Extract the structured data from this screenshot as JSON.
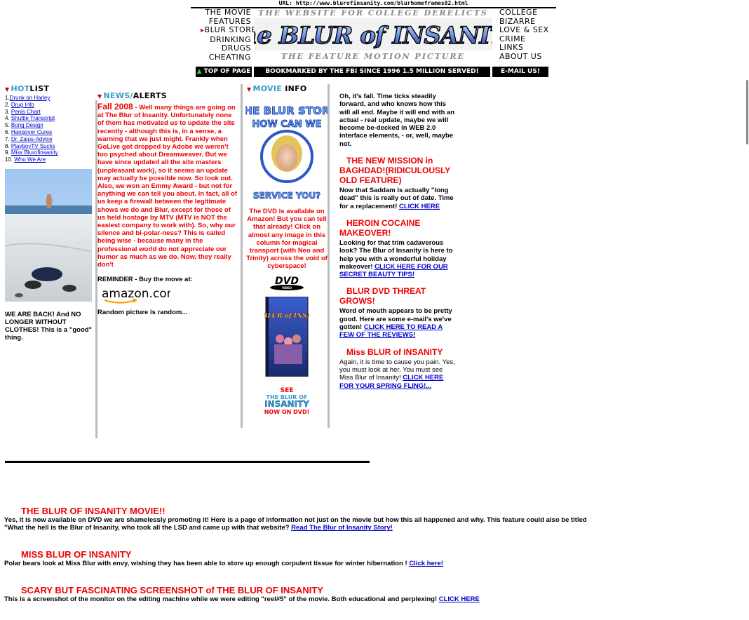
{
  "banner": {
    "url": "URL: http://www.blurofinsanity.com/blurhomeframes02.html",
    "tagline_top": "THE WEBSITE FOR COLLEGE DERELICTS",
    "logo_text": "The BLUR of INSANITY",
    "tagline_bottom": "THE FEATURE MOTION PICTURE",
    "nav_left": [
      "THE MOVIE",
      "FEATURES",
      "BLUR STORE",
      "DRINKING",
      "DRUGS",
      "CHEATING"
    ],
    "nav_right": [
      "COLLEGE",
      "BIZARRE",
      "LOVE & SEX",
      "CRIME",
      "LINKS",
      "ABOUT US"
    ],
    "top_of_page": "TOP OF PAGE",
    "bookmarked": "BOOKMARKED BY THE FBI SINCE 1996  1.5 MILLION SERVED!",
    "email": "E-MAIL US!"
  },
  "hotlist": {
    "title_a": "HOT",
    "title_b": "LIST",
    "items": [
      {
        "num": "1.",
        "label": "Drunk on Harley"
      },
      {
        "num": "2.",
        "label": "Drug Info"
      },
      {
        "num": "3.",
        "label": "Penis Chart"
      },
      {
        "num": "4.",
        "label": "Shuttle Transcript"
      },
      {
        "num": "5.",
        "label": "Bong Design"
      },
      {
        "num": "6.",
        "label": "Hangover Cures"
      },
      {
        "num": "7.",
        "label": "Dr. Zaius-Advice"
      },
      {
        "num": "8.",
        "label": "PlayboyTV Sucks"
      },
      {
        "num": "9.",
        "label": "Miss Blurofinsanity"
      },
      {
        "num": "10.",
        "label": "Who We Are"
      }
    ],
    "back_text": "WE ARE BACK! And NO LONGER WITHOUT CLOTHES! This is a \"good\" thing."
  },
  "news": {
    "title_a": "NEWS/",
    "title_b": "ALERTS",
    "season": "Fall 2008",
    "body": " - Well many things are going on at The Blur of Insanity. Unfortunately none of them has motivated us to update the site recently - although this is, in a sense, a warning that we just might. Frankly when GoLive got dropped by Adobe we weren't too psyched about Dreamweaver. But we have since updated all the site masters (unpleasant work), so it seems an update may actually be possible now. So look out. Also, we won an Emmy Award - but not for anything we can tell you about. In fact, all of us keep a firewall between the legitimate shows we do and Blur, except for those of us held hostage by MTV (MTV is NOT the easiest company to work with). So, why our silence and bi-polar-ness? This is called being wise - because many in the professional world do not appreciate our humor as much as we do. Now, they really don't",
    "reminder": "REMINDER - Buy the move at:",
    "amazon": "amazon.com",
    "random": "Random picture is random..."
  },
  "movie": {
    "title_a": "MOVIE ",
    "title_b": "INFO",
    "store_top": "THE BLUR STORE",
    "store_mid": "HOW CAN WE",
    "store_bot": "SERVICE YOU?",
    "dvd_text": "The DVD is available on Amazon! But you can tell that already! Click on almost any image in this column for magical transport (with Neo and Trinity) across the void of cyberspace!",
    "dvd_logo": "DVD",
    "dvd_video": "VIDEO",
    "box_title": "The BLUR of INSANITY",
    "see_1": "SEE",
    "see_2": "THE BLUR OF",
    "see_3": "INSANITY",
    "see_4": "NOW ON DVD!"
  },
  "features": {
    "intro": "Oh, it's fall. Time ticks steadily forward, and who knows how this will all end. Maybe it will end with an actual - real update, maybe we will become be-decked in WEB 2.0 interface elements, - or, well, maybe not.",
    "items": [
      {
        "title": "THE NEW MISSION in BAGHDAD!(RIDICULOUSLY OLD FEATURE)",
        "text": "Now that Saddam is actually \"long dead\" this is really out of date. Time for a replacement! ",
        "link": "CLICK HERE"
      },
      {
        "title": "HEROIN COCAINE MAKEOVER!",
        "text": "Looking for that trim cadaverous look? The Blur of Insanity is here to help you with a wonderful holiday makeover! ",
        "link": "CLICK HERE FOR OUR SECRET BEAUTY TIPS!"
      },
      {
        "title": "BLUR DVD THREAT GROWS!",
        "text": "Word of mouth appears to be pretty good. Here are some e-mail's we've gotten! ",
        "link": "CLICK HERE TO READ A FEW OF THE REVIEWS!"
      },
      {
        "title": "Miss BLUR of INSANITY",
        "text": "Again, it is time to cause you pain. Yes, you must look at her. You must see Miss Blur of Insanity! ",
        "link": "CLICK HERE FOR YOUR SPRING FLING!..."
      }
    ]
  },
  "bottom": [
    {
      "title": "THE BLUR OF INSANITY MOVIE!!",
      "text": "Yes, it is now available on DVD we are shamelessly promoting it! Here is a page of information not just on the movie but how this all happened and why. This feature could also be titled \"What the hell is the Blur of Insanity, who took all the LSD and came up with that website? ",
      "link": "Read The Blur of Insanity Story!"
    },
    {
      "title": "MISS BLUR OF INSANITY",
      "text": "Polar bears look at Miss Blur with envy, wishing they has been able to store up enough corpulent tissue for winter hibernation ! ",
      "link": "Click here!"
    },
    {
      "title": "SCARY BUT FASCINATING SCREENSHOT of THE BLUR OF INSANITY",
      "text": "This is a screenshot of the monitor on the editing machine while we were editing \"reel#5\" of the movie. Both educational and perplexing! ",
      "link": "CLICK HERE"
    }
  ],
  "colors": {
    "accent_red": "#e00",
    "link_blue": "#00c",
    "heading_blue": "#39c"
  }
}
